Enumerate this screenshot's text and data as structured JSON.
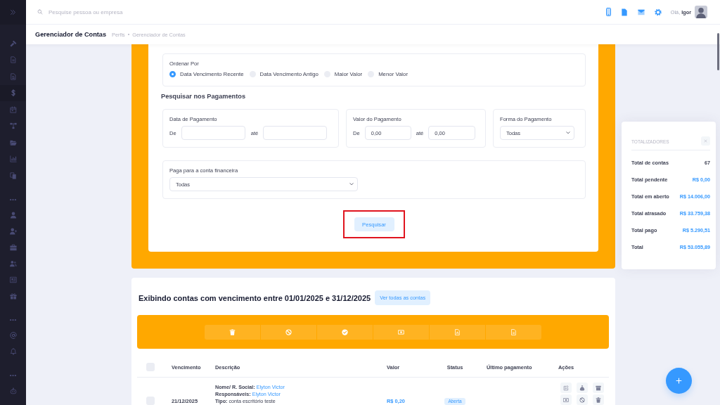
{
  "sidebar": {
    "groups": [
      {
        "items": [
          {
            "selected": false
          },
          {
            "selected": false
          },
          {
            "selected": false
          },
          {
            "selected": true
          },
          {
            "selected": false
          },
          {
            "selected": false
          },
          {
            "selected": false
          },
          {
            "selected": false
          },
          {
            "selected": false
          }
        ]
      },
      {
        "items": [
          {
            "selected": false
          },
          {
            "selected": false
          },
          {
            "selected": false
          },
          {
            "selected": false
          },
          {
            "selected": false
          },
          {
            "selected": false
          }
        ]
      },
      {
        "items": [
          {
            "selected": false
          },
          {
            "selected": false
          }
        ]
      },
      {
        "items": [
          {
            "selected": false
          }
        ]
      }
    ]
  },
  "topbar": {
    "search": {
      "placeholder": "Pesquise pessoa ou empresa"
    },
    "greeting": "Olá, **Igor**"
  },
  "header": {
    "title": "Gerenciador de Contas",
    "breadcrumb": [
      "Perfis",
      "Gerenciador de Contas"
    ]
  },
  "filters": {
    "sort": {
      "label": "Ordenar Por",
      "options": [
        {
          "label": "Data Vencimento Recente",
          "selected": true
        },
        {
          "label": "Data Vencimento Antigo",
          "selected": false
        },
        {
          "label": "Maior Valor",
          "selected": false
        },
        {
          "label": "Menor Valor",
          "selected": false
        }
      ]
    },
    "payments_heading": "Pesquisar nos Pagamentos",
    "payment_date": {
      "label": "Data de Pagamento",
      "from": {
        "label": "De"
      },
      "to": {
        "label": "até"
      }
    },
    "payment_value": {
      "label": "Valor do Pagamento",
      "from": {
        "label": "De",
        "value": "0,00"
      },
      "to": {
        "label": "até",
        "value": "0,00"
      }
    },
    "payment_method": {
      "label": "Forma do Pagamento",
      "value": "Todas"
    },
    "account": {
      "label": "Paga para a conta financeira",
      "value": "Todas"
    },
    "search_button": {
      "label": "Pesquisar",
      "highlighted": true
    }
  },
  "totals": {
    "title": "TOTALIZADORES",
    "rows": [
      {
        "label": "Total de contas",
        "value": "67",
        "kind": "count"
      },
      {
        "label": "Total pendente",
        "value": "R$ 0,00",
        "kind": "currency"
      },
      {
        "label": "Total em aberto",
        "value": "R$ 14.006,00",
        "kind": "currency"
      },
      {
        "label": "Total atrasado",
        "value": "R$ 33.759,38",
        "kind": "currency"
      },
      {
        "label": "Total pago",
        "value": "R$ 5.290,51",
        "kind": "currency"
      },
      {
        "label": "Total",
        "value": "R$ 53.055,89",
        "kind": "currency"
      }
    ]
  },
  "accounts": {
    "title": "Exibindo contas com vencimento entre 01/01/2025 e 31/12/2025",
    "view_all_button": "Ver todas as contas",
    "table": {
      "select_all": {
        "checked": false
      },
      "columns": [
        "Vencimento",
        "Descrição",
        "Valor",
        "Status",
        "Último pagamento",
        "Ações"
      ],
      "rows": [
        {
          "checked": false,
          "due_date": "21/12/2025",
          "description": [
            {
              "label": "Nome/ R. Social:",
              "value": "Elyton Victor",
              "kind": "link"
            },
            {
              "label": "Responsáveis:",
              "value": "Elyton Victor",
              "kind": "link"
            },
            {
              "label": "Tipo:",
              "value": "conta escritório teste",
              "kind": "text"
            }
          ],
          "amount": "R$ 0,20",
          "status": "Aberta"
        }
      ]
    }
  }
}
